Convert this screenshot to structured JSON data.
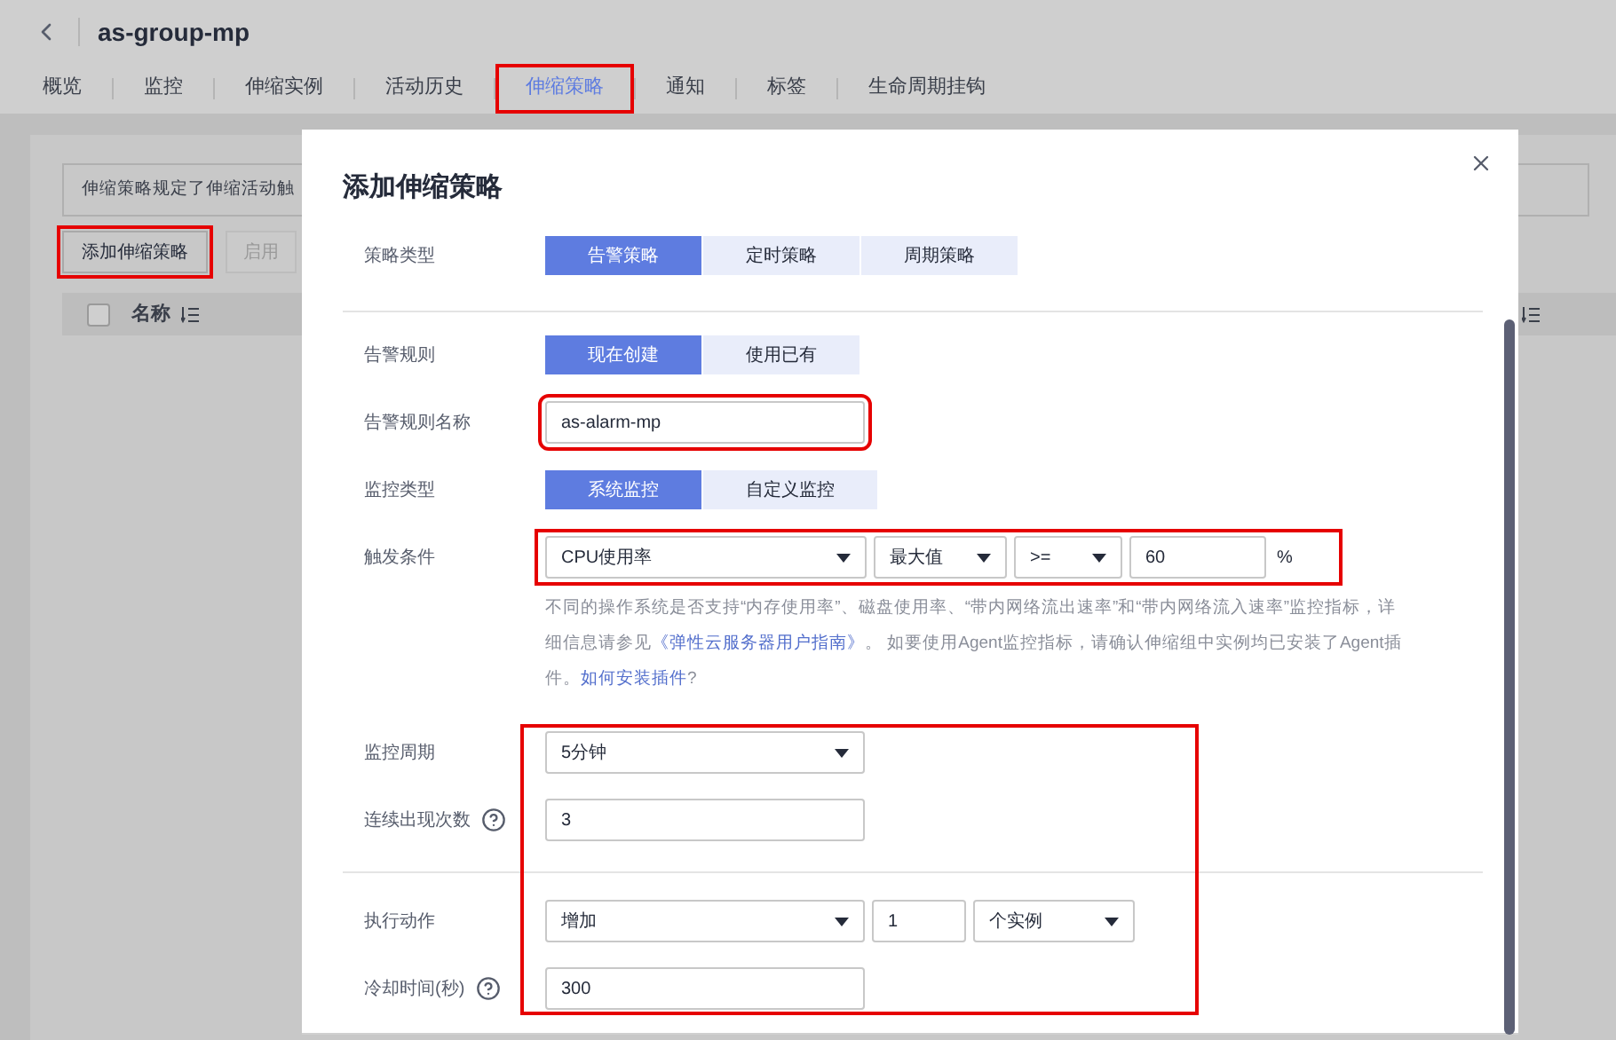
{
  "header": {
    "title": "as-group-mp"
  },
  "tabs": [
    {
      "label": "概览",
      "selected": false,
      "highlighted": false
    },
    {
      "label": "监控",
      "selected": false,
      "highlighted": false
    },
    {
      "label": "伸缩实例",
      "selected": false,
      "highlighted": false
    },
    {
      "label": "活动历史",
      "selected": false,
      "highlighted": false
    },
    {
      "label": "伸缩策略",
      "selected": true,
      "highlighted": true
    },
    {
      "label": "通知",
      "selected": false,
      "highlighted": false
    },
    {
      "label": "标签",
      "selected": false,
      "highlighted": false
    },
    {
      "label": "生命周期挂钩",
      "selected": false,
      "highlighted": false
    }
  ],
  "page": {
    "notice": "伸缩策略规定了伸缩活动触",
    "buttons": [
      {
        "label": "添加伸缩策略",
        "disabled": false,
        "highlighted": true
      },
      {
        "label": "启用",
        "disabled": true,
        "highlighted": false
      }
    ],
    "table": {
      "select_all": {
        "checked": false
      },
      "columns": [
        "名称"
      ]
    }
  },
  "dialog": {
    "title": "添加伸缩策略",
    "sections": [
      [
        {
          "label": "策略类型",
          "kind": "segmented",
          "options": [
            {
              "label": "告警策略",
              "selected": true
            },
            {
              "label": "定时策略",
              "selected": false
            },
            {
              "label": "周期策略",
              "selected": false
            }
          ]
        }
      ],
      [
        {
          "label": "告警规则",
          "kind": "segmented",
          "options": [
            {
              "label": "现在创建",
              "selected": true
            },
            {
              "label": "使用已有",
              "selected": false
            }
          ]
        },
        {
          "label": "告警规则名称",
          "kind": "controls",
          "controls": [
            {
              "kind": "input",
              "value": "as-alarm-mp",
              "highlighted": true
            }
          ]
        },
        {
          "label": "监控类型",
          "kind": "segmented",
          "options": [
            {
              "label": "系统监控",
              "selected": true
            },
            {
              "label": "自定义监控",
              "selected": false
            }
          ]
        },
        {
          "label": "触发条件",
          "kind": "controls",
          "highlighted": true,
          "controls": [
            {
              "kind": "select",
              "value": "CPU使用率"
            },
            {
              "kind": "select",
              "value": "最大值"
            },
            {
              "kind": "select",
              "value": ">="
            },
            {
              "kind": "input",
              "value": "60"
            }
          ],
          "unit": "%",
          "help": [
            {
              "kind": "text",
              "text": "不同的操作系统是否支持“内存使用率”、磁盘使用率、“带内网络流出速率”和“带内网络流入速率”监控指标，详细信息请参见"
            },
            {
              "kind": "link",
              "text": "《弹性云服务器用户指南》"
            },
            {
              "kind": "text",
              "text": "。 如要使用Agent监控指标，请确认伸缩组中实例均已安装了Agent插件。"
            },
            {
              "kind": "link",
              "text": "如何安装插件"
            },
            {
              "kind": "text",
              "text": "?"
            }
          ]
        },
        {
          "label": "监控周期",
          "kind": "controls",
          "controls": [
            {
              "kind": "select",
              "value": "5分钟"
            }
          ]
        },
        {
          "label": "连续出现次数",
          "kind": "controls",
          "help_icon": true,
          "controls": [
            {
              "kind": "input",
              "value": "3"
            }
          ]
        }
      ],
      [
        {
          "label": "执行动作",
          "kind": "controls",
          "controls": [
            {
              "kind": "select",
              "value": "增加"
            },
            {
              "kind": "input",
              "value": "1"
            },
            {
              "kind": "select",
              "value": "个实例"
            }
          ]
        },
        {
          "label": "冷却时间(秒)",
          "kind": "controls",
          "help_icon": true,
          "controls": [
            {
              "kind": "input",
              "value": "300"
            }
          ]
        }
      ]
    ]
  }
}
